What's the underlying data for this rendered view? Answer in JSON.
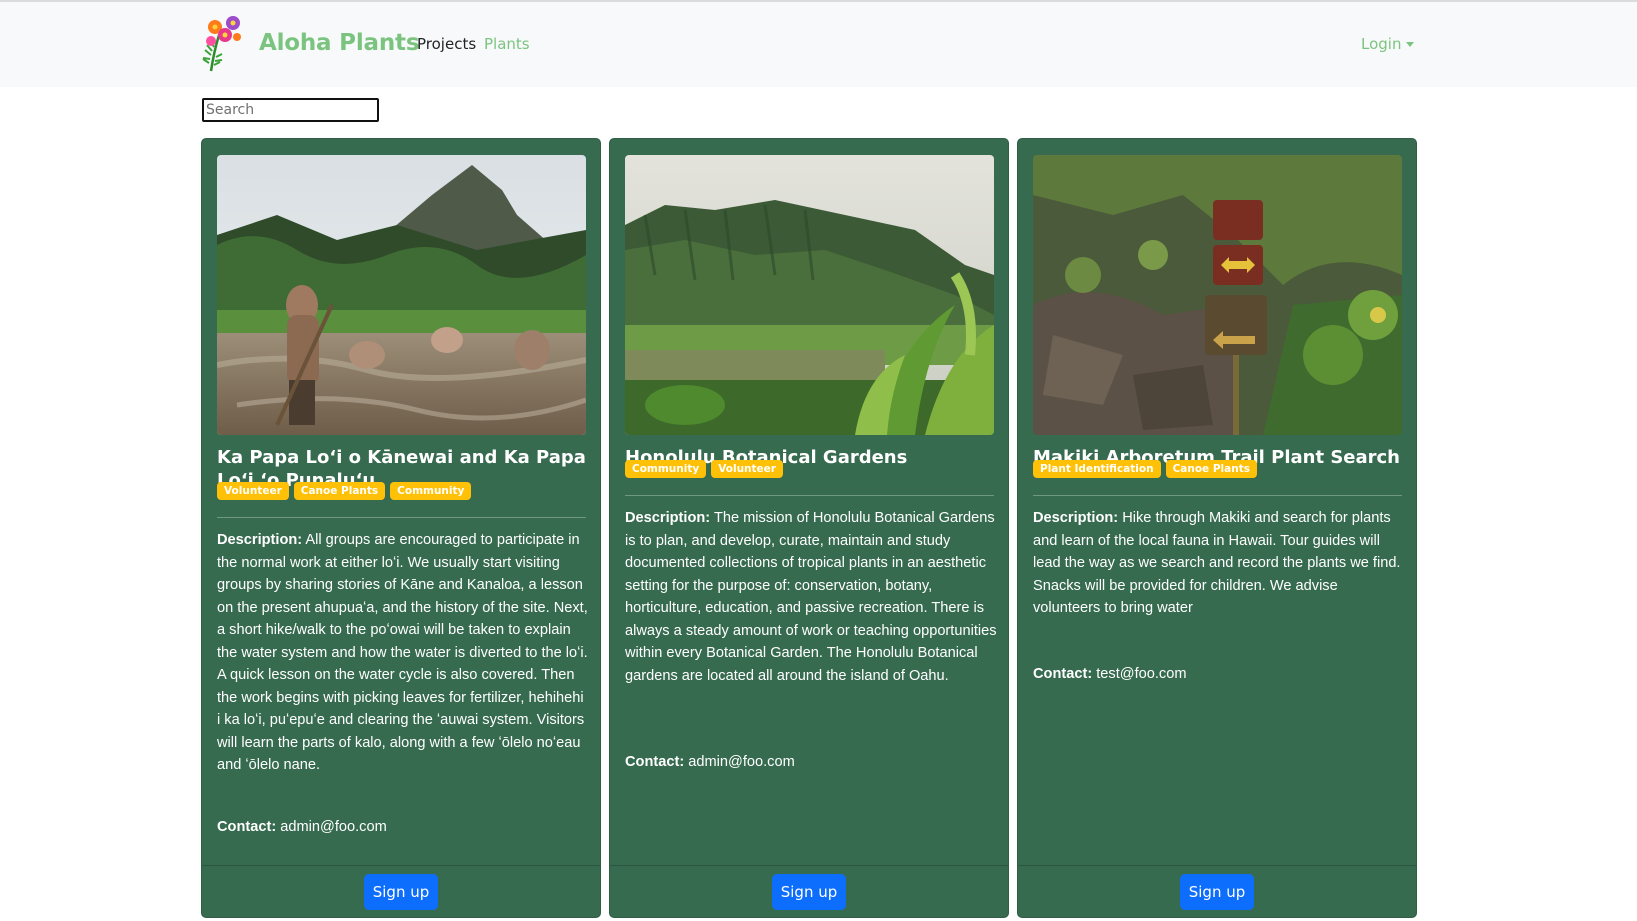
{
  "navbar": {
    "brand": "Aloha Plants",
    "links": [
      "Projects",
      "Plants"
    ],
    "login": "Login"
  },
  "search": {
    "placeholder": "Search",
    "value": ""
  },
  "cards": [
    {
      "title": "Ka Papa Loʻi o Kānewai and Ka Papa Loʻi ʻo Punaluʻu",
      "badges": [
        "Volunteer",
        "Canoe Plants",
        "Community"
      ],
      "description_label": "Description:",
      "description": "All groups are encouraged to participate in the normal work at either loʻi. We usually start visiting groups by sharing stories of Kāne and Kanaloa, a lesson on the present ahupuaʻa, and the history of the site. Next, a short hike/walk to the poʻowai will be taken to explain the water system and how the water is diverted to the loʻi. A quick lesson on the water cycle is also covered. Then the work begins with picking leaves for fertilizer, hehihehi i ka loʻi, puʻepuʻe and clearing the ʻauwai system. Visitors will learn the parts of kalo, along with a few ʻōlelo noʻeau and ʻōlelo nane.",
      "contact_label": "Contact:",
      "contact": "admin@foo.com",
      "button": "Sign up",
      "image": "taro-field-photo"
    },
    {
      "title": "Honolulu Botanical Gardens",
      "badges": [
        "Community",
        "Volunteer"
      ],
      "description_label": "Description:",
      "description": "The mission of Honolulu Botanical Gardens is to plan, and develop, curate, maintain and study documented collections of tropical plants in an aesthetic setting for the purpose of: conservation, botany, horticulture, education, and passive recreation. There is always a steady amount of work or teaching opportunities within every Botanical Garden. The Honolulu Botanical gardens are located all around the island of Oahu.",
      "contact_label": "Contact:",
      "contact": "admin@foo.com",
      "button": "Sign up",
      "image": "botanical-garden-photo"
    },
    {
      "title": "Makiki Arboretum Trail Plant Search",
      "badges": [
        "Plant Identification",
        "Canoe Plants"
      ],
      "description_label": "Description:",
      "description": "Hike through Makiki and search for plants and learn of the local fauna in Hawaii. Tour guides will lead the way as we search and record the plants we find. Snacks will be provided for children. We advise volunteers to bring water",
      "contact_label": "Contact:",
      "contact": "test@foo.com",
      "button": "Sign up",
      "image": "trail-sign-photo"
    }
  ],
  "colors": {
    "brand_green": "#7bc47f",
    "card_bg": "#366b4f",
    "badge": "#ffc107",
    "button": "#0d6efd"
  }
}
